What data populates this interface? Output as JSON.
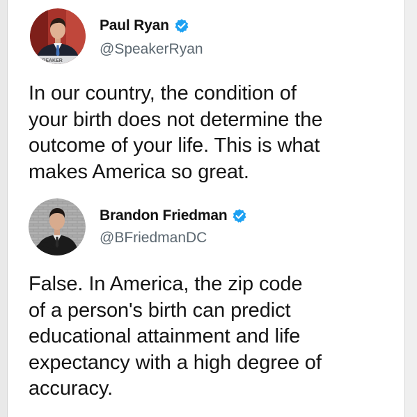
{
  "tweets": [
    {
      "display_name": "Paul Ryan",
      "handle": "@SpeakerRyan",
      "verified": true,
      "text": "In our country, the condition of\nyour birth does not determine the\noutcome of your life. This is what\nmakes America so great.",
      "avatar_icon": "person-photo-icon",
      "avatar_caption": "SPEAKER"
    },
    {
      "display_name": "Brandon Friedman",
      "handle": "@BFriedmanDC",
      "verified": true,
      "text": "False. In America, the zip code\nof a person's birth can predict\neducational attainment and life\nexpectancy with a high degree of\naccuracy.",
      "avatar_icon": "person-photo-icon"
    }
  ],
  "colors": {
    "verified_badge": "#1da1f2",
    "handle": "#5b6770",
    "text": "#141414"
  }
}
